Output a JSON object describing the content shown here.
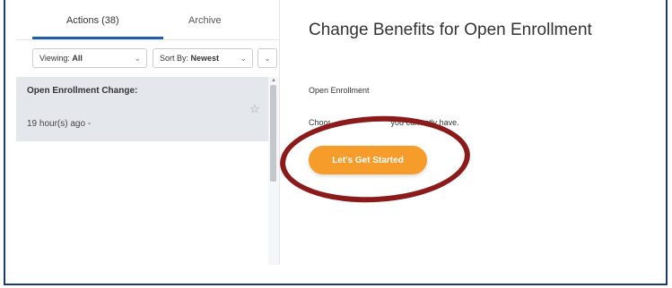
{
  "tabs": {
    "actions_label": "Actions (38)",
    "archive_label": "Archive"
  },
  "filters": {
    "viewing_prefix": "Viewing: ",
    "viewing_value": "All",
    "sort_prefix": "Sort By: ",
    "sort_value": "Newest",
    "chevron": "⌵"
  },
  "inbox_item": {
    "title": "Open Enrollment Change:",
    "time": "19 hour(s) ago -"
  },
  "main": {
    "title": "Change Benefits for Open Enrollment",
    "section_label": "Open Enrollment",
    "instruction": "Choos                          roll in the plans you currently have.",
    "start_button": "Let's Get Started"
  },
  "annotation": {
    "color": "#8b1a1a"
  },
  "colors": {
    "accent_orange": "#f59c2b",
    "tab_underline": "#1f5fa8"
  }
}
